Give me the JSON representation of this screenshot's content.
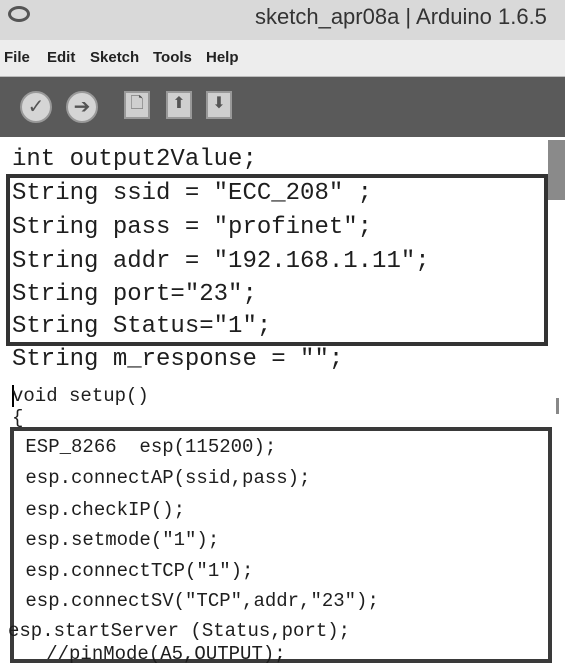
{
  "window": {
    "title": "sketch_apr08a | Arduino 1.6.5"
  },
  "menu": {
    "items": [
      "File",
      "Edit",
      "Sketch",
      "Tools",
      "Help"
    ]
  },
  "toolbar": {
    "buttons": [
      {
        "name": "verify-button",
        "icon": "check-icon",
        "glyph": "✓"
      },
      {
        "name": "upload-button",
        "icon": "arrow-right-icon",
        "glyph": "➔"
      },
      {
        "name": "new-button",
        "icon": "new-file-icon",
        "glyph": "🗋"
      },
      {
        "name": "open-button",
        "icon": "arrow-up-icon",
        "glyph": "⬆"
      },
      {
        "name": "save-button",
        "icon": "arrow-down-icon",
        "glyph": "⬇"
      }
    ]
  },
  "code": {
    "lines": [
      "int output2Value;",
      "String ssid = \"ECC_208\" ;",
      "String pass = \"profinet\";",
      "String addr = \"192.168.1.11\";",
      "String port=\"23\";",
      "String Status=\"1\";",
      "String m_response = \"\";",
      "void setup()",
      "{",
      " ESP_8266  esp(115200);",
      " esp.connectAP(ssid,pass);",
      " esp.checkIP();",
      " esp.setmode(\"1\");",
      " esp.connectTCP(\"1\");",
      " esp.connectSV(\"TCP\",addr,\"23\");",
      "esp.startServer (Status,port);",
      "   //pinMode(A5,OUTPUT);"
    ]
  }
}
